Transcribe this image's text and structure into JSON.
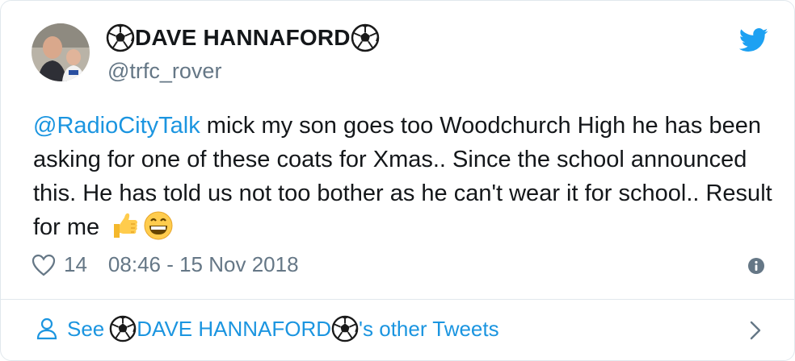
{
  "tweet": {
    "display_name": "DAVE HANNAFORD",
    "handle": "@trfc_rover",
    "mention": "@RadioCityTalk",
    "body_text": " mick my son goes too Woodchurch High he has been asking for one of these coats for Xmas.. Since the school announced this. He has told us not too bother as he can't wear it for school.. Result for me",
    "likes": "14",
    "timestamp": "08:46 - 15 Nov 2018",
    "emojis": [
      "thumbs-up",
      "grinning-face"
    ]
  },
  "footer": {
    "see_label": "See",
    "name": "DAVE HANNAFORD",
    "suffix": "'s other Tweets"
  },
  "icons": {
    "bird": "twitter-bird-icon",
    "heart": "heart-icon",
    "info": "info-icon",
    "person": "person-icon",
    "chevron": "chevron-right-icon",
    "ball": "soccer-ball-icon"
  },
  "colors": {
    "link": "#1b95e0",
    "muted": "#657786",
    "bird": "#1da1f2"
  }
}
